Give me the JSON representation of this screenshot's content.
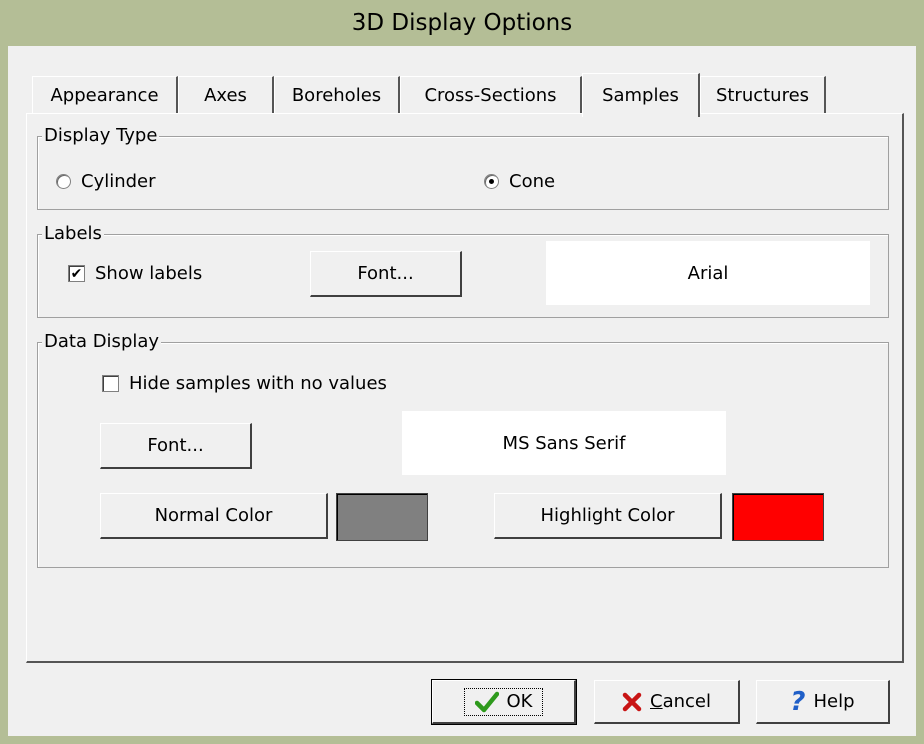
{
  "window": {
    "title": "3D Display Options"
  },
  "tabs": [
    {
      "label": "Appearance",
      "active": false
    },
    {
      "label": "Axes",
      "active": false
    },
    {
      "label": "Boreholes",
      "active": false
    },
    {
      "label": "Cross-Sections",
      "active": false
    },
    {
      "label": "Samples",
      "active": true
    },
    {
      "label": "Structures",
      "active": false
    }
  ],
  "display_type": {
    "title": "Display Type",
    "options": [
      {
        "label": "Cylinder",
        "checked": false
      },
      {
        "label": "Cone",
        "checked": true
      }
    ]
  },
  "labels": {
    "title": "Labels",
    "show_labels": {
      "label": "Show labels",
      "checked": true
    },
    "font_button": "Font...",
    "font_preview": "Arial"
  },
  "data_display": {
    "title": "Data Display",
    "hide_samples": {
      "label": "Hide samples with no values",
      "checked": false
    },
    "font_button": "Font...",
    "font_preview": "MS Sans Serif",
    "normal_color_button": "Normal Color",
    "normal_color": "#808080",
    "highlight_color_button": "Highlight Color",
    "highlight_color": "#ff0000"
  },
  "footer": {
    "ok": {
      "label": "OK",
      "icon": "check-icon"
    },
    "cancel": {
      "label_underline": "C",
      "label_rest": "ancel",
      "icon": "x-icon"
    },
    "help": {
      "label": "Help",
      "icon": "question-icon"
    }
  },
  "colors": {
    "titlebar": "#b4be96",
    "face": "#f0f0f0"
  }
}
